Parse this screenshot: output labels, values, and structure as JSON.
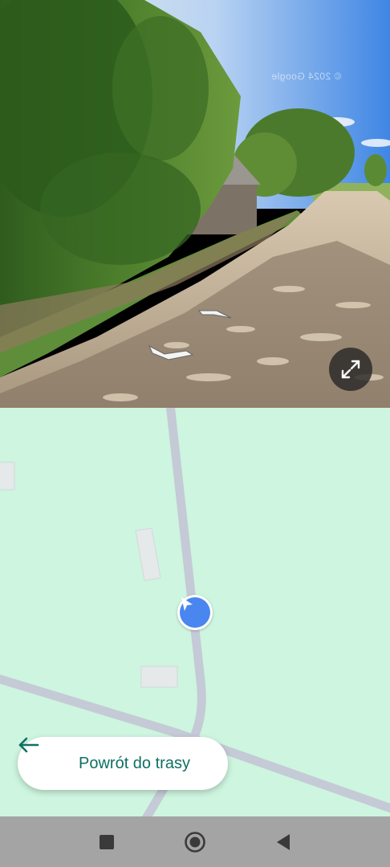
{
  "street_view": {
    "watermark_text": "© 2024 Google",
    "expand_icon": "expand-diagonal-icon",
    "nav_arrows": [
      "streetview-arrow-forward",
      "streetview-arrow-back"
    ]
  },
  "map": {
    "background_color": "#cef5df",
    "road_color": "#c5cad7",
    "building_color": "#e6e9ea",
    "location_marker_color": "#4a86f0",
    "location_icon": "navigation-arrow-icon"
  },
  "return_button": {
    "label": "Powrót do trasy",
    "icon": "arrow-left-icon",
    "accent_color": "#0f6f63"
  },
  "system_nav": {
    "recents_icon": "square-icon",
    "home_icon": "circle-icon",
    "back_icon": "triangle-back-icon"
  }
}
